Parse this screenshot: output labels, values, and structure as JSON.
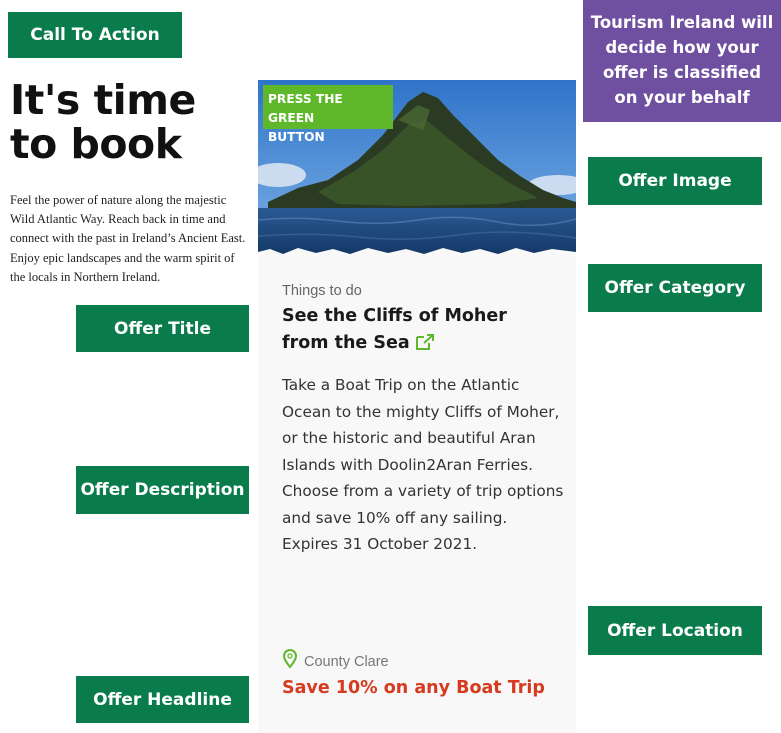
{
  "labels": {
    "call_to_action": "Call To Action",
    "offer_title": "Offer Title",
    "offer_description": "Offer Description",
    "offer_headline": "Offer Headline",
    "offer_image": "Offer Image",
    "offer_category": "Offer Category",
    "offer_location": "Offer Location"
  },
  "classification_note": {
    "line1": "Tourism Ireland will",
    "line2": "decide how your",
    "line3": "offer is classified",
    "line4": "on your behalf"
  },
  "left": {
    "headline": "It's time to book",
    "intro": "Feel the power of nature along the majestic Wild Atlantic Way. Reach back in time and connect with the past in Ireland’s Ancient East. Enjoy epic landscapes and the warm spirit of the locals in Northern Ireland."
  },
  "card": {
    "banner_line1": "PRESS THE GREEN",
    "banner_line2": "BUTTON",
    "category": "Things to do",
    "title": "See the Cliffs of Moher from the Sea",
    "description": "Take a Boat Trip on the Atlantic Ocean to the mighty Cliffs of Moher, or the historic and beautiful Aran Islands with Doolin2Aran Ferries. Choose from a variety of trip options and save 10% off any sailing. Expires 31 October 2021.",
    "location": "County Clare",
    "offer": "Save 10% on any Boat Trip",
    "external_link_icon": "external-link-icon",
    "location_icon": "map-pin-icon"
  },
  "colors": {
    "tag_green": "#0a7c4b",
    "banner_green": "#5fb82a",
    "note_purple": "#6f4fa0",
    "offer_red": "#d43b1f"
  }
}
